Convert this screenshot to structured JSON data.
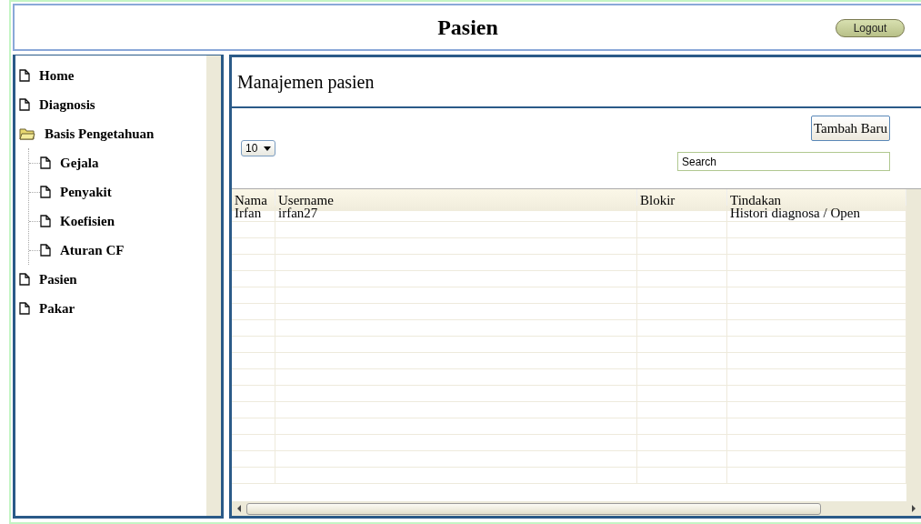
{
  "header": {
    "title": "Pasien",
    "logout": "Logout"
  },
  "sidebar": {
    "items": [
      {
        "label": "Home"
      },
      {
        "label": "Diagnosis"
      },
      {
        "label": "Basis Pengetahuan",
        "expanded": true,
        "children": [
          {
            "label": "Gejala"
          },
          {
            "label": "Penyakit"
          },
          {
            "label": "Koefisien"
          },
          {
            "label": "Aturan CF"
          }
        ]
      },
      {
        "label": "Pasien"
      },
      {
        "label": "Pakar"
      }
    ]
  },
  "main": {
    "title": "Manajemen pasien",
    "add_button": "Tambah Baru",
    "page_size": "10",
    "search": {
      "placeholder": "Search"
    }
  },
  "table": {
    "columns": [
      "Nama",
      "Username",
      "Blokir",
      "Tindakan"
    ],
    "rows": [
      [
        "Irfan",
        "irfan27",
        "",
        "Histori diagnosa / Open"
      ]
    ]
  }
}
